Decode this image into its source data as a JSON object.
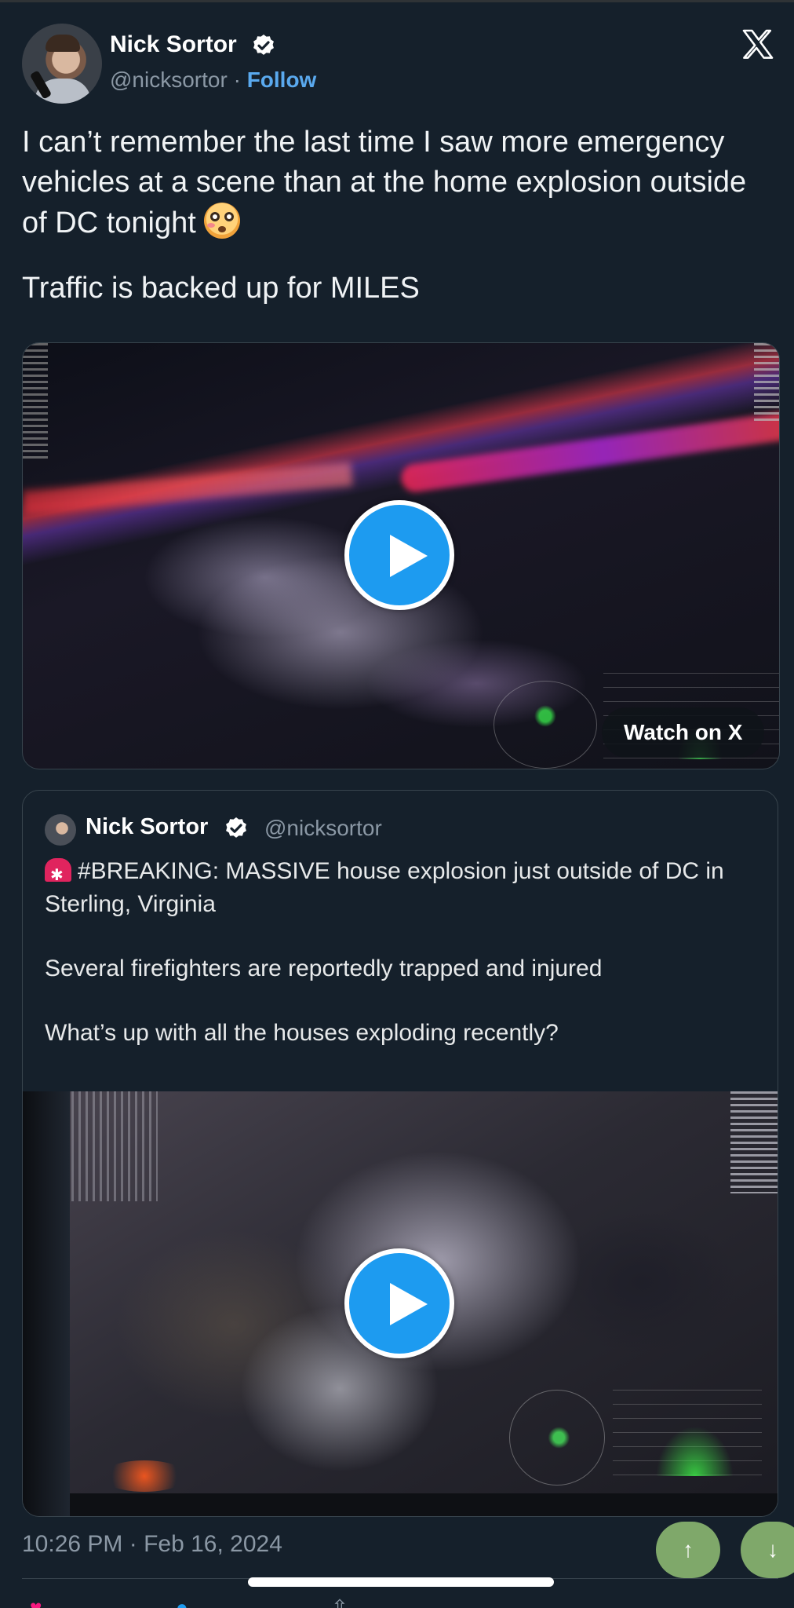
{
  "author": {
    "name": "Nick Sortor",
    "handle": "@nicksortor",
    "separator": "·",
    "follow_label": "Follow"
  },
  "tweet": {
    "line1": "I can’t remember the last time I saw more emergency vehicles at a scene than at the home explosion outside of DC tonight",
    "emoji": "flushed-face-emoji",
    "line2": "Traffic is backed up for MILES"
  },
  "media": {
    "watch_label": "Watch on X",
    "play_icon": "play-icon"
  },
  "quoted": {
    "name": "Nick Sortor",
    "handle": "@nicksortor",
    "emoji": "rotating-light-emoji",
    "p1": "#BREAKING: MASSIVE house explosion just outside of DC in Sterling, Virginia",
    "p2": "Several firefighters are reportedly trapped and injured",
    "p3": "What’s up with all the houses exploding recently?"
  },
  "footer": {
    "timestamp": "10:26 PM · Feb 16, 2024",
    "scroll_up": "↑",
    "scroll_down": "↓"
  },
  "colors": {
    "background": "#15202b",
    "accent": "#1d9bf0",
    "follow": "#5aa9ee",
    "scroll_button": "#7fa86a"
  }
}
